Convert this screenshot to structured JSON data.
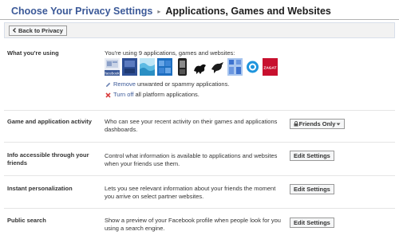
{
  "header": {
    "title": "Choose Your Privacy Settings",
    "separator": "▸",
    "current": "Applications, Games and Websites"
  },
  "toolbar": {
    "back_label": "Back to Privacy"
  },
  "using": {
    "label": "What you're using",
    "summary": "You're using 9 applications, games and websites:",
    "apps": [
      "facebook",
      "blue-tile-app",
      "wave-app",
      "grid-app",
      "phone-app",
      "animal-app",
      "bird-app",
      "blue-pattern-app",
      "circle-app",
      "zagat"
    ],
    "zagat_label": "ZAGAT",
    "facebook_label": "facebook",
    "remove_link": "Remove",
    "remove_rest": "unwanted or spammy applications.",
    "turnoff_link": "Turn off",
    "turnoff_rest": "all platform applications."
  },
  "settings": [
    {
      "label": "Game and application activity",
      "description": "Who can see your recent activity on their games and applications dashboards.",
      "button": "Friends Only"
    },
    {
      "label": "Info accessible through your friends",
      "description": "Control what information is available to applications and websites when your friends use them.",
      "button": "Edit Settings"
    },
    {
      "label": "Instant personalization",
      "description": "Lets you see relevant information about your friends the moment you arrive on select partner websites.",
      "button": "Edit Settings"
    },
    {
      "label": "Public search",
      "description": "Show a preview of your Facebook profile when people look for you using a search engine.",
      "button": "Edit Settings"
    }
  ],
  "colors": {
    "link": "#3b5998",
    "heading": "#3b5998",
    "zagat_red": "#c8102e",
    "turnoff_red": "#d93f3f"
  }
}
